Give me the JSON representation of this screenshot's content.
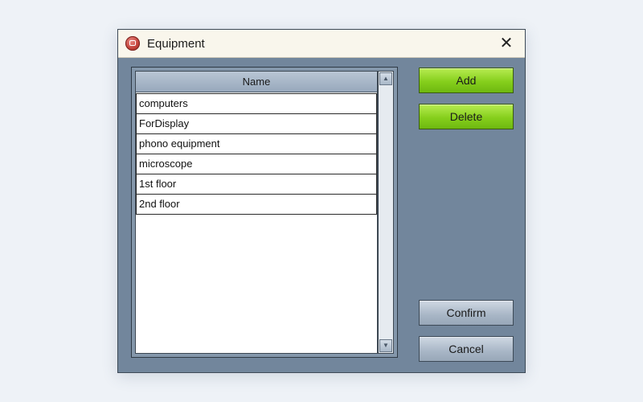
{
  "window": {
    "title": "Equipment",
    "close_symbol": "✕"
  },
  "list": {
    "column_header": "Name",
    "items": [
      "computers",
      "ForDisplay",
      "phono equipment",
      "microscope",
      "1st floor",
      "2nd floor"
    ],
    "scroll_up_symbol": "▲",
    "scroll_down_symbol": "▼"
  },
  "buttons": {
    "add": "Add",
    "delete": "Delete",
    "confirm": "Confirm",
    "cancel": "Cancel"
  },
  "colors": {
    "panel": "#72869c",
    "green_button": "#86cf1c",
    "gray_button": "#a8b6c6",
    "titlebar": "#f9f6ec"
  },
  "icons": {
    "app": "equipment-app-icon",
    "close": "close-icon"
  }
}
